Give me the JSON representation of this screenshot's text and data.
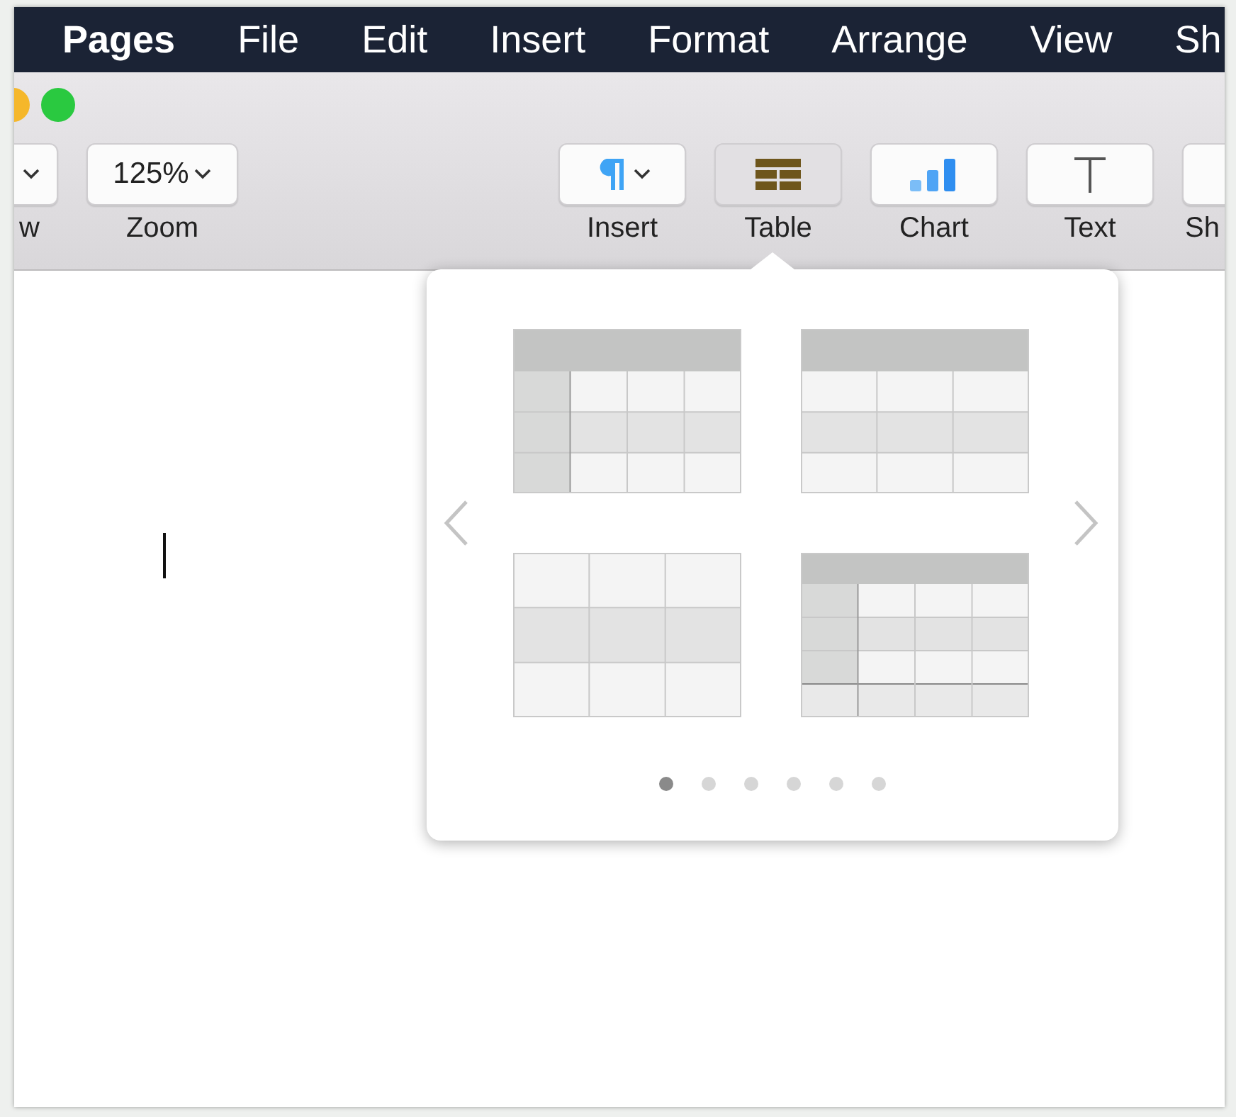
{
  "menu_bar": [
    {
      "label": "Pages",
      "kind": "app"
    },
    {
      "label": "File",
      "kind": "menu"
    },
    {
      "label": "Edit",
      "kind": "menu"
    },
    {
      "label": "Insert",
      "kind": "menu"
    },
    {
      "label": "Format",
      "kind": "menu"
    },
    {
      "label": "Arrange",
      "kind": "menu"
    },
    {
      "label": "View",
      "kind": "menu"
    },
    {
      "label": "Sh",
      "kind": "menu"
    }
  ],
  "toolbar": {
    "left": [
      {
        "label": "w"
      },
      {
        "label": "Zoom",
        "value": "125%"
      }
    ],
    "right": [
      {
        "label": "Insert",
        "kind": "insert",
        "selected": false
      },
      {
        "label": "Table",
        "kind": "table",
        "selected": true
      },
      {
        "label": "Chart",
        "kind": "chart",
        "selected": false
      },
      {
        "label": "Text",
        "kind": "text",
        "selected": false
      },
      {
        "label": "Sh",
        "kind": "shape",
        "selected": false
      }
    ]
  },
  "table_popover": {
    "styles": [
      {
        "kind": "header-row-column"
      },
      {
        "kind": "header-row"
      },
      {
        "kind": "plain"
      },
      {
        "kind": "header-row-column-footer"
      }
    ],
    "pages": [
      {
        "selected": true
      },
      {
        "selected": false
      },
      {
        "selected": false
      },
      {
        "selected": false
      },
      {
        "selected": false
      },
      {
        "selected": false
      }
    ]
  }
}
